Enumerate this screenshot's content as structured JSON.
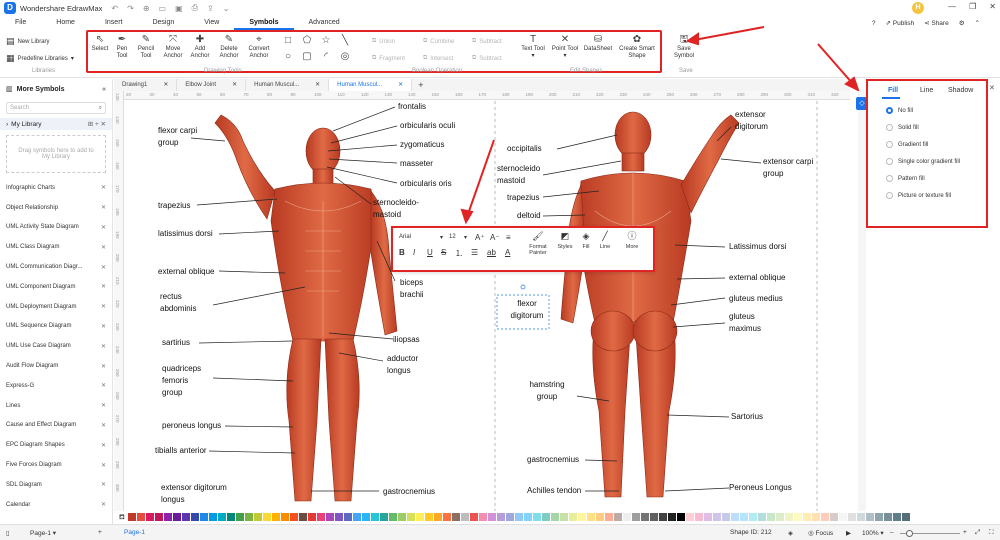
{
  "window": {
    "app_title": "Wondershare EdrawMax",
    "user_initial": "H"
  },
  "menu": {
    "tabs": [
      "File",
      "Home",
      "Insert",
      "Design",
      "View",
      "Symbols",
      "Advanced"
    ],
    "active": "Symbols",
    "right": {
      "publish": "Publish",
      "share": "Share"
    }
  },
  "ribbon": {
    "libraries": {
      "new_library": "New Library",
      "predefine": "Predefine Libraries",
      "group": "Libraries"
    },
    "drawing_tools": {
      "group": "Drawing Tools",
      "buttons": [
        "Select",
        "Pen Tool",
        "Pencil Tool",
        "Move Anchor",
        "Add Anchor",
        "Delete Anchor",
        "Convert Anchor"
      ]
    },
    "boolean": {
      "group": "Boolean Operation",
      "items": [
        "Union",
        "Combine",
        "Subtract",
        "Fragment",
        "Intersect",
        "Subtract"
      ]
    },
    "edit_shapes": {
      "group": "Edit Shapes",
      "buttons": [
        "Text Tool",
        "Point Tool",
        "DataSheet",
        "Create Smart Shape"
      ]
    },
    "save": {
      "label": "Save Symbol",
      "group": "Save"
    }
  },
  "sidebar": {
    "title": "More Symbols",
    "search_placeholder": "Search",
    "my_library": "My Library",
    "drop_hint": "Drag symbols here to add to My Library",
    "items": [
      "Infographic Charts",
      "Object Relationship",
      "UML Activity State Diagram",
      "UML Class Diagram",
      "UML Communication Diagr...",
      "UML Component Diagram",
      "UML Deployment Diagram",
      "UML Sequence Diagram",
      "UML Use Case Diagram",
      "Audit Flow Diagram",
      "Express-G",
      "Lines",
      "Cause and Effect Diagram",
      "EPC Diagram Shapes",
      "Five Forces Diagram",
      "SDL Diagram",
      "Calendar"
    ]
  },
  "doc_tabs": [
    "Drawing1",
    "Elbow Joint",
    "Human Muscul...",
    "Human Muscul..."
  ],
  "ruler": {
    "h_ticks": [
      "20",
      "30",
      "40",
      "50",
      "60",
      "70",
      "80",
      "90",
      "100",
      "110",
      "120",
      "130",
      "140",
      "150",
      "160",
      "170",
      "180",
      "190",
      "200",
      "210",
      "220",
      "230",
      "240",
      "250",
      "260",
      "270",
      "280",
      "290",
      "300",
      "310",
      "320"
    ],
    "v_ticks": [
      "130",
      "140",
      "150",
      "160",
      "170",
      "180",
      "190",
      "200",
      "210",
      "220",
      "230",
      "240",
      "250",
      "260",
      "270",
      "280",
      "290",
      "300"
    ]
  },
  "labels_front": [
    "flexor carpi group",
    "frontalis",
    "orbicularis oculi",
    "zygomaticus",
    "masseter",
    "orbicularis oris",
    "trapezius",
    "sternocleido-mastoid",
    "latissimus dorsi",
    "external oblique",
    "biceps brachii",
    "rectus abdominis",
    "sartirius",
    "iliopsas",
    "adductor longus",
    "quadriceps femoris group",
    "peroneus longus",
    "tibialls anterior",
    "extensor digitorum longus",
    "gastrocnemius"
  ],
  "labels_back": [
    "occipitalis",
    "sternocleido mastoid",
    "trapezius",
    "deltoid",
    "extensor digitorum",
    "extensor carpi group",
    "Latissimus dorsi",
    "external oblique",
    "gluteus medius",
    "gluteus maximus",
    "flexor digitorum",
    "hamstring group",
    "Sartorius",
    "gastrocnemius",
    "Achilles tendon",
    "Peroneus Longus"
  ],
  "floating_toolbar": {
    "font": "Arial",
    "size": "12",
    "buttons": [
      "Format Painter",
      "Styles",
      "Fill",
      "Line",
      "More"
    ]
  },
  "fill_panel": {
    "tabs": [
      "Fill",
      "Line",
      "Shadow"
    ],
    "options": [
      "No fill",
      "Solid fill",
      "Gradient fill",
      "Single color gradient fill",
      "Pattern fill",
      "Picture or texture fill"
    ],
    "selected": "No fill"
  },
  "palette": [
    "#c0392b",
    "#e74c3c",
    "#d81b60",
    "#c2185b",
    "#8e24aa",
    "#6a1b9a",
    "#5e35b1",
    "#3949ab",
    "#1e88e5",
    "#039be5",
    "#00acc1",
    "#00897b",
    "#43a047",
    "#7cb342",
    "#c0ca33",
    "#fdd835",
    "#ffb300",
    "#fb8c00",
    "#f4511e",
    "#6d4c41",
    "#e53935",
    "#ec407a",
    "#ab47bc",
    "#7e57c2",
    "#5c6bc0",
    "#42a5f5",
    "#29b6f6",
    "#26c6da",
    "#26a69a",
    "#66bb6a",
    "#9ccc65",
    "#d4e157",
    "#ffee58",
    "#ffca28",
    "#ffa726",
    "#ff7043",
    "#8d6e63",
    "#bdbdbd",
    "#ef5350",
    "#f48fb1",
    "#ce93d8",
    "#b39ddb",
    "#9fa8da",
    "#90caf9",
    "#81d4fa",
    "#80deea",
    "#80cbc4",
    "#a5d6a7",
    "#c5e1a5",
    "#e6ee9c",
    "#fff59d",
    "#ffe082",
    "#ffcc80",
    "#ffab91",
    "#bcaaa4",
    "#eeeeee",
    "#9e9e9e",
    "#757575",
    "#616161",
    "#424242",
    "#212121",
    "#000000",
    "#ffcdd2",
    "#f8bbd0",
    "#e1bee7",
    "#d1c4e9",
    "#c5cae9",
    "#bbdefb",
    "#b3e5fc",
    "#b2ebf2",
    "#b2dfdb",
    "#c8e6c9",
    "#dcedc8",
    "#f0f4c3",
    "#fff9c4",
    "#ffecb3",
    "#ffe0b2",
    "#ffccbc",
    "#d7ccc8",
    "#f5f5f5",
    "#e0e0e0",
    "#cfd8dc",
    "#b0bec5",
    "#90a4ae",
    "#78909c",
    "#607d8b",
    "#546e7a"
  ],
  "status": {
    "page_selector": "Page-1",
    "page_tab": "Page-1",
    "shape_id": "Shape ID: 212",
    "focus": "Focus",
    "zoom": "100%"
  }
}
